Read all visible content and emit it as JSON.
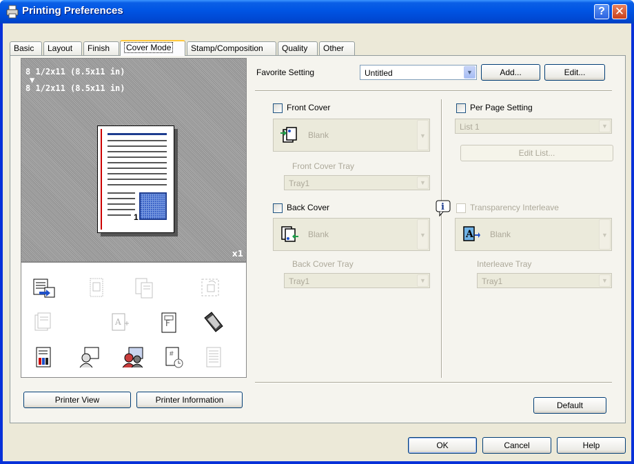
{
  "window": {
    "title": "Printing Preferences"
  },
  "tabs": [
    {
      "label": "Basic"
    },
    {
      "label": "Layout"
    },
    {
      "label": "Finish"
    },
    {
      "label": "Cover Mode"
    },
    {
      "label": "Stamp/Composition"
    },
    {
      "label": "Quality"
    },
    {
      "label": "Other"
    }
  ],
  "preview": {
    "paper_line1": "8 1/2x11 (8.5x11 in)",
    "arrow": "▼",
    "paper_line2": "8 1/2x11 (8.5x11 in)",
    "page_number": "1",
    "copies": "x1"
  },
  "left_buttons": {
    "printer_view": "Printer View",
    "printer_information": "Printer Information"
  },
  "favorite": {
    "label": "Favorite Setting",
    "value": "Untitled",
    "add": "Add...",
    "edit": "Edit..."
  },
  "front_cover": {
    "label": "Front Cover",
    "paper": "Blank",
    "tray_label": "Front Cover Tray",
    "tray": "Tray1"
  },
  "back_cover": {
    "label": "Back Cover",
    "paper": "Blank",
    "tray_label": "Back Cover Tray",
    "tray": "Tray1"
  },
  "per_page": {
    "label": "Per Page Setting",
    "list": "List 1",
    "edit_list": "Edit List..."
  },
  "transparency": {
    "label": "Transparency Interleave",
    "paper": "Blank",
    "tray_label": "Interleave Tray",
    "tray": "Tray1"
  },
  "footer": {
    "default": "Default",
    "ok": "OK",
    "cancel": "Cancel",
    "help": "Help"
  },
  "colors": {
    "title_bar": "#0054e3",
    "dialog_bg": "#ece9d8",
    "tab_highlight": "#ffc83c"
  }
}
